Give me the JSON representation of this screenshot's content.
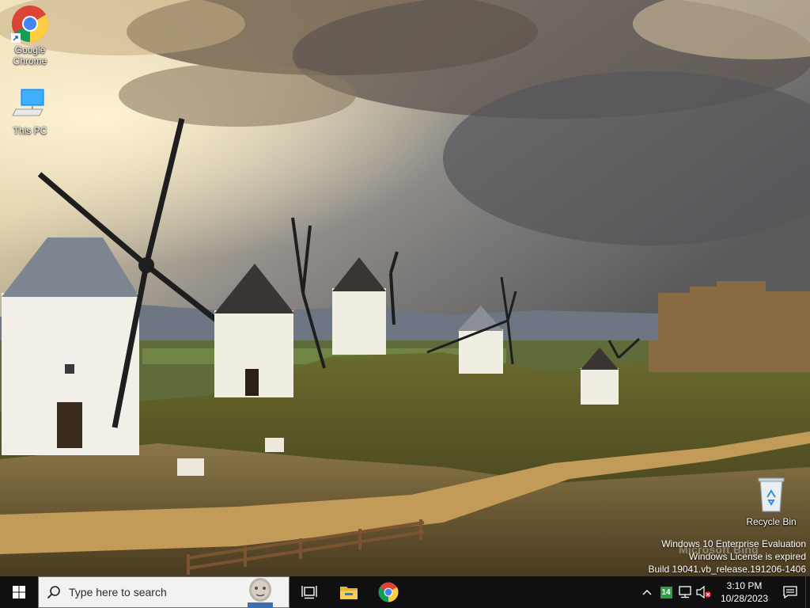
{
  "desktop": {
    "icons": [
      {
        "label_line1": "Google",
        "label_line2": "Chrome",
        "icon": "chrome-icon"
      },
      {
        "label": "This PC",
        "icon": "computer-icon"
      },
      {
        "label": "Recycle Bin",
        "icon": "recycle-bin-icon"
      }
    ],
    "watermark": {
      "line1": "Windows 10 Enterprise Evaluation",
      "line2": "Windows License is expired",
      "line3": "Build 19041.vb_release.191206-1406"
    },
    "bing_mark": "Microsoft Bing"
  },
  "taskbar": {
    "search_placeholder": "Type here to search",
    "apps": [
      {
        "name": "Task View",
        "icon": "task-view-icon"
      },
      {
        "name": "File Explorer",
        "icon": "file-explorer-icon"
      },
      {
        "name": "Google Chrome",
        "icon": "chrome-icon"
      }
    ],
    "tray": {
      "badge": "14",
      "time": "3:10 PM",
      "date": "10/28/2023"
    }
  },
  "colors": {
    "taskbar_bg": "#101010",
    "accent": "#76b9ed",
    "search_bg": "#f2f2f2"
  }
}
